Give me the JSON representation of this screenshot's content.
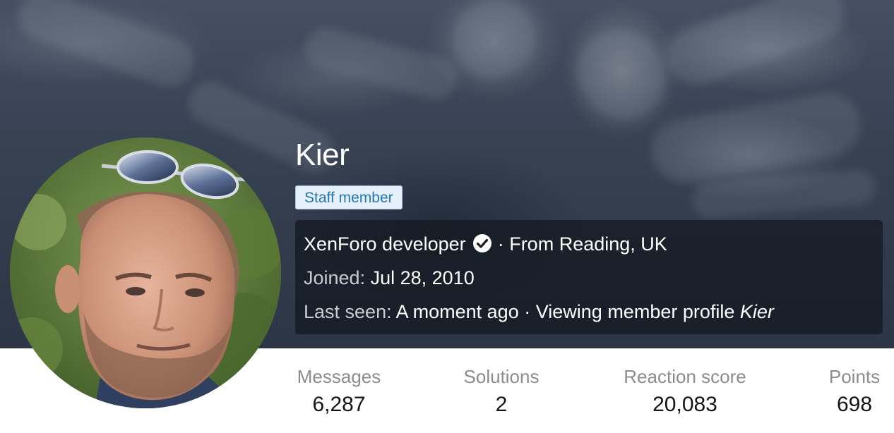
{
  "profile": {
    "name": "Kier",
    "badge": "Staff member",
    "title": "XenForo developer",
    "location_sep": "·",
    "location": "From Reading, UK",
    "joined_label": "Joined:",
    "joined_value": "Jul 28, 2010",
    "last_seen_label": "Last seen:",
    "last_seen_value": "A moment ago",
    "activity_sep": "·",
    "activity": "Viewing member profile",
    "activity_target": "Kier"
  },
  "stats": [
    {
      "label": "Messages",
      "value": "6,287"
    },
    {
      "label": "Solutions",
      "value": "2"
    },
    {
      "label": "Reaction score",
      "value": "20,083"
    },
    {
      "label": "Points",
      "value": "698"
    }
  ],
  "colors": {
    "badge_text": "#2577b1",
    "badge_bg": "#e6f0fa",
    "badge_border": "#a8c6e6",
    "stat_label": "#8c8c8c",
    "info_box_bg": "#14181e"
  },
  "icons": {
    "verified": "check-circle-icon"
  }
}
